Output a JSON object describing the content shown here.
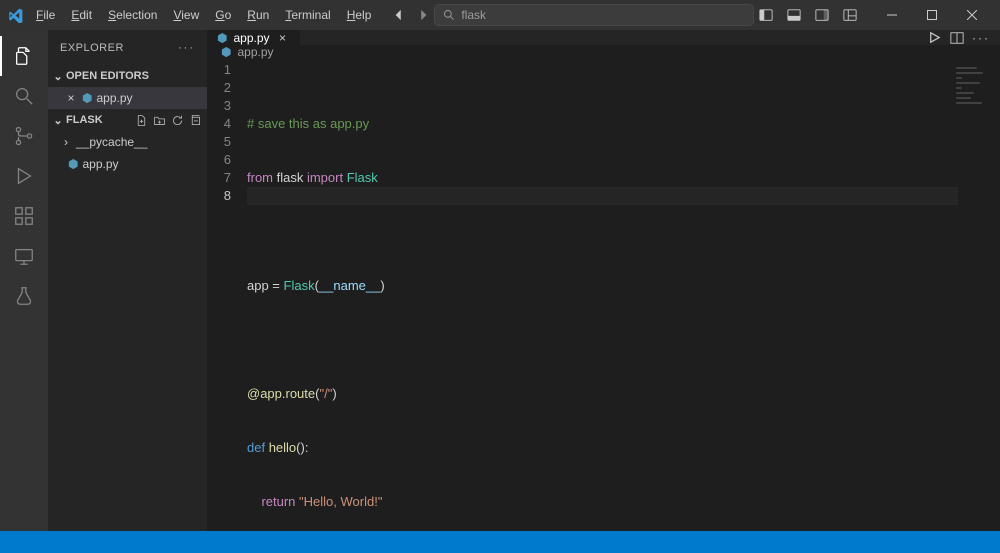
{
  "menu": {
    "file": "File",
    "edit": "Edit",
    "selection": "Selection",
    "view": "View",
    "go": "Go",
    "run": "Run",
    "terminal": "Terminal",
    "help": "Help"
  },
  "search": {
    "placeholder": "flask"
  },
  "sidebar": {
    "title": "EXPLORER",
    "open_editors_label": "OPEN EDITORS",
    "open_editor_file": "app.py",
    "folder_label": "FLASK",
    "tree": {
      "pycache": "__pycache__",
      "app": "app.py"
    }
  },
  "tabs": {
    "active": "app.py"
  },
  "breadcrumb": {
    "file": "app.py"
  },
  "code": {
    "lines": [
      "1",
      "2",
      "3",
      "4",
      "5",
      "6",
      "7",
      "8"
    ],
    "l1": "# save this as app.py",
    "l2a": "from",
    "l2b": " flask ",
    "l2c": "import",
    "l2d": " Flask",
    "l4a": "app = ",
    "l4b": "Flask",
    "l4c": "(",
    "l4d": "__name__",
    "l4e": ")",
    "l6a": "@app.route",
    "l6b": "(",
    "l6c": "\"/\"",
    "l6d": ")",
    "l7a": "def ",
    "l7b": "hello",
    "l7c": "():",
    "l8a": "    ",
    "l8b": "return ",
    "l8c": "\"Hello, World!\""
  }
}
